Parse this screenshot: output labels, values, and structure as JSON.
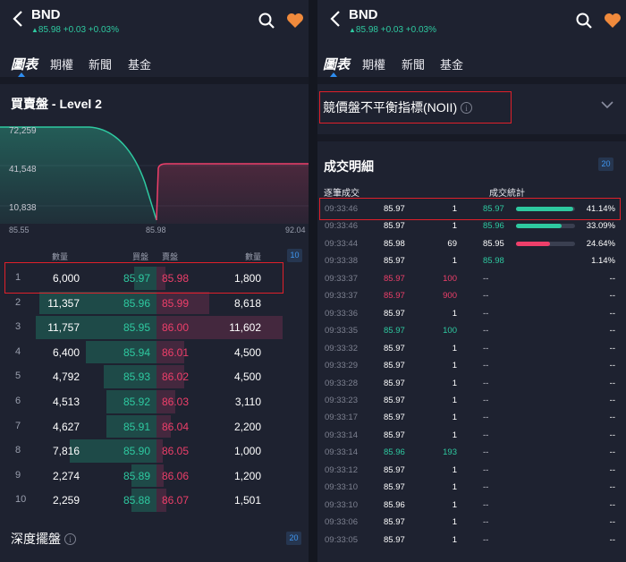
{
  "header": {
    "symbol": "BND",
    "quote": "85.98 +0.03 +0.03%",
    "quote_arrow": "▲"
  },
  "tabs": [
    "圖表",
    "期權",
    "新聞",
    "基金"
  ],
  "left": {
    "section_title": "買賣盤 - Level 2",
    "chart": {
      "y_labels": [
        "72,259",
        "41,548",
        "10,838"
      ],
      "x_labels": [
        "85.55",
        "85.98",
        "92.04"
      ]
    },
    "book_headers": {
      "bid_qty": "數量",
      "bid": "買盤",
      "ask": "賣盤",
      "ask_qty": "數量",
      "levels_badge": "10"
    },
    "book_rows": [
      {
        "idx": "1",
        "bid_qty": "6,000",
        "bid": "85.97",
        "ask": "85.98",
        "ask_qty": "1,800",
        "bid_depth": 0.18,
        "ask_depth": 0.07
      },
      {
        "idx": "2",
        "bid_qty": "11,357",
        "bid": "85.96",
        "ask": "85.99",
        "ask_qty": "8,618",
        "bid_depth": 0.93,
        "ask_depth": 0.42
      },
      {
        "idx": "3",
        "bid_qty": "11,757",
        "bid": "85.95",
        "ask": "86.00",
        "ask_qty": "11,602",
        "bid_depth": 0.96,
        "ask_depth": 1.0
      },
      {
        "idx": "4",
        "bid_qty": "6,400",
        "bid": "85.94",
        "ask": "86.01",
        "ask_qty": "4,500",
        "bid_depth": 0.56,
        "ask_depth": 0.22
      },
      {
        "idx": "5",
        "bid_qty": "4,792",
        "bid": "85.93",
        "ask": "86.02",
        "ask_qty": "4,500",
        "bid_depth": 0.42,
        "ask_depth": 0.22
      },
      {
        "idx": "6",
        "bid_qty": "4,513",
        "bid": "85.92",
        "ask": "86.03",
        "ask_qty": "3,110",
        "bid_depth": 0.4,
        "ask_depth": 0.15
      },
      {
        "idx": "7",
        "bid_qty": "4,627",
        "bid": "85.91",
        "ask": "86.04",
        "ask_qty": "2,200",
        "bid_depth": 0.4,
        "ask_depth": 0.11
      },
      {
        "idx": "8",
        "bid_qty": "7,816",
        "bid": "85.90",
        "ask": "86.05",
        "ask_qty": "1,000",
        "bid_depth": 0.69,
        "ask_depth": 0.05
      },
      {
        "idx": "9",
        "bid_qty": "2,274",
        "bid": "85.89",
        "ask": "86.06",
        "ask_qty": "1,200",
        "bid_depth": 0.2,
        "ask_depth": 0.06
      },
      {
        "idx": "10",
        "bid_qty": "2,259",
        "bid": "85.88",
        "ask": "86.07",
        "ask_qty": "1,501",
        "bid_depth": 0.2,
        "ask_depth": 0.08
      }
    ],
    "depth_title": "深度擺盤",
    "depth_badge": "20",
    "info_glyph": "i"
  },
  "right": {
    "noii_title": "競價盤不平衡指標(NOII)",
    "trades_title": "成交明細",
    "trades_badge": "20",
    "trades_sub": "逐筆成交",
    "stats_sub": "成交統計",
    "trades": [
      {
        "time": "09:33:46",
        "price": "85.97",
        "price_color": "w",
        "vol": "1",
        "vol_color": "w"
      },
      {
        "time": "09:33:46",
        "price": "85.97",
        "price_color": "w",
        "vol": "1",
        "vol_color": "w"
      },
      {
        "time": "09:33:44",
        "price": "85.98",
        "price_color": "w",
        "vol": "69",
        "vol_color": "w"
      },
      {
        "time": "09:33:38",
        "price": "85.97",
        "price_color": "w",
        "vol": "1",
        "vol_color": "w"
      },
      {
        "time": "09:33:37",
        "price": "85.97",
        "price_color": "r",
        "vol": "100",
        "vol_color": "r"
      },
      {
        "time": "09:33:37",
        "price": "85.97",
        "price_color": "r",
        "vol": "900",
        "vol_color": "r"
      },
      {
        "time": "09:33:36",
        "price": "85.97",
        "price_color": "w",
        "vol": "1",
        "vol_color": "w"
      },
      {
        "time": "09:33:35",
        "price": "85.97",
        "price_color": "g",
        "vol": "100",
        "vol_color": "g"
      },
      {
        "time": "09:33:32",
        "price": "85.97",
        "price_color": "w",
        "vol": "1",
        "vol_color": "w"
      },
      {
        "time": "09:33:29",
        "price": "85.97",
        "price_color": "w",
        "vol": "1",
        "vol_color": "w"
      },
      {
        "time": "09:33:28",
        "price": "85.97",
        "price_color": "w",
        "vol": "1",
        "vol_color": "w"
      },
      {
        "time": "09:33:23",
        "price": "85.97",
        "price_color": "w",
        "vol": "1",
        "vol_color": "w"
      },
      {
        "time": "09:33:17",
        "price": "85.97",
        "price_color": "w",
        "vol": "1",
        "vol_color": "w"
      },
      {
        "time": "09:33:14",
        "price": "85.97",
        "price_color": "w",
        "vol": "1",
        "vol_color": "w"
      },
      {
        "time": "09:33:14",
        "price": "85.96",
        "price_color": "g",
        "vol": "193",
        "vol_color": "g"
      },
      {
        "time": "09:33:12",
        "price": "85.97",
        "price_color": "w",
        "vol": "1",
        "vol_color": "w"
      },
      {
        "time": "09:33:10",
        "price": "85.97",
        "price_color": "w",
        "vol": "1",
        "vol_color": "w"
      },
      {
        "time": "09:33:10",
        "price": "85.96",
        "price_color": "w",
        "vol": "1",
        "vol_color": "w"
      },
      {
        "time": "09:33:06",
        "price": "85.97",
        "price_color": "w",
        "vol": "1",
        "vol_color": "w"
      },
      {
        "time": "09:33:05",
        "price": "85.97",
        "price_color": "w",
        "vol": "1",
        "vol_color": "w"
      }
    ],
    "stats": [
      {
        "price": "85.97",
        "color": "g",
        "pct": "41.14%",
        "share": 0.4114
      },
      {
        "price": "85.96",
        "color": "g",
        "pct": "33.09%",
        "share": 0.3309
      },
      {
        "price": "85.95",
        "color": "w",
        "pct": "24.64%",
        "share": 0.2464
      },
      {
        "price": "85.98",
        "color": "g",
        "pct": "1.14%",
        "share": 0.0114
      }
    ],
    "empty": "--"
  },
  "colors": {
    "bg": "#1e2230",
    "green": "#2ec9a0",
    "red": "#ee3f6a",
    "blue": "#2e8df0",
    "highlight": "#e0202a",
    "heart": "#f08a3c"
  }
}
